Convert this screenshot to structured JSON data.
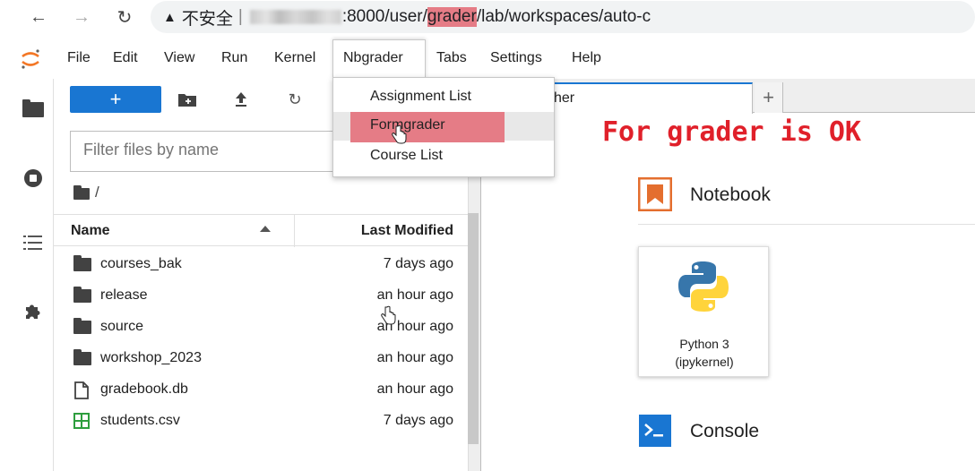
{
  "browser": {
    "url_insecure": "不安全",
    "url_separator": "|",
    "url_port": ":8000/user/",
    "url_highlight": "grader",
    "url_rest": "/lab/workspaces/auto-c",
    "highlight_color": "#e57c86"
  },
  "menubar": {
    "items": [
      "File",
      "Edit",
      "View",
      "Run",
      "Kernel",
      "Nbgrader",
      "Tabs",
      "Settings",
      "Help"
    ],
    "active": "Nbgrader"
  },
  "nbgrader_menu": {
    "items": [
      "Assignment List",
      "Formgrader",
      "Course List"
    ],
    "highlighted": "Formgrader"
  },
  "filebrowser": {
    "new_label": "+",
    "filter_placeholder": "Filter files by name",
    "breadcrumb": "/",
    "header_name": "Name",
    "header_modified": "Last Modified",
    "files": [
      {
        "name": "courses_bak",
        "modified": "7 days ago",
        "icon": "folder-icon"
      },
      {
        "name": "release",
        "modified": "an hour ago",
        "icon": "folder-icon"
      },
      {
        "name": "source",
        "modified": "an hour ago",
        "icon": "folder-icon"
      },
      {
        "name": "workshop_2023",
        "modified": "an hour ago",
        "icon": "folder-icon"
      },
      {
        "name": "gradebook.db",
        "modified": "an hour ago",
        "icon": "file-icon"
      },
      {
        "name": "students.csv",
        "modified": "7 days ago",
        "icon": "spreadsheet-icon"
      }
    ]
  },
  "launcher": {
    "tab_label": "her",
    "add_tab": "+",
    "annotation": "For grader is OK",
    "notebook_section": "Notebook",
    "kernel_name": "Python 3",
    "kernel_sub": "(ipykernel)",
    "console_section": "Console"
  },
  "colors": {
    "accent": "#1976d2",
    "annotation": "#e0202a",
    "highlight": "#e57c86"
  }
}
